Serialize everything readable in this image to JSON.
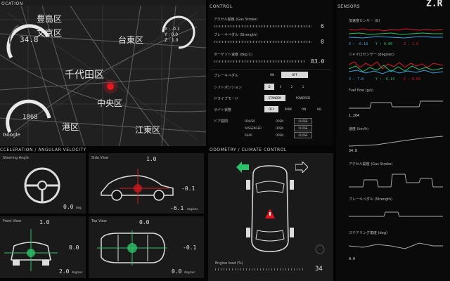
{
  "header": {
    "location_title": "OCATION",
    "control_title": "CONTROL",
    "sensors_title": "SENSORS",
    "accel_title": "CCELERATION / ANGULAR VELOCITY",
    "odo_title": "ODOMETRY / CLIMATE CONTROL",
    "logo": "Z.R"
  },
  "map": {
    "wards": [
      "豊島区",
      "文京区",
      "台東区",
      "千代田区",
      "中央区",
      "港区",
      "江東区"
    ],
    "speed_value": "34.8",
    "rpm_value": "1868",
    "google_label": "Google",
    "accel_x": "X : -0.1",
    "accel_y": "Y : 0.0",
    "accel_z": "Z : 1.0"
  },
  "control": {
    "accel_label": "アクセル開度 (Gas Stroke)",
    "accel_value": "6",
    "brake_label": "ブレーキペダル (Strength)",
    "brake_value": "0",
    "target_label": "ターゲット速度 (deg C)",
    "target_value": "83.0",
    "brake_pedal_label": "ブレーキペダル",
    "on_label": "ON",
    "off_label": "OFF",
    "shift_label": "シフトポジション",
    "shift_options": [
      "D",
      "3",
      "2",
      "1"
    ],
    "drive_label": "ドライブモード",
    "drive_options": [
      "STANDBY",
      "POWERED"
    ],
    "light_label": "ライト状態",
    "light_options": [
      "OFF",
      "PARK",
      "ON",
      "HB"
    ],
    "door_label": "ドア開閉",
    "door_rows": [
      {
        "name": "DRIVER",
        "state": "OPEN",
        "button": "CLOSE"
      },
      {
        "name": "PASSENGER",
        "state": "OPEN",
        "button": "CLOSE"
      },
      {
        "name": "REAR",
        "state": "OPEN",
        "button": "CLOSE"
      }
    ]
  },
  "sensors": {
    "accel_sensor_label": "加速度センサー (G)",
    "accel_readings": [
      "X : -0.18",
      "Y : 0.00",
      "Z : 1.0"
    ],
    "gyro_label": "ジャイロセンサー (deg/sec)",
    "gyro_readings": [
      "X : 7.8",
      "Y : -6.14",
      "Z : 0.02"
    ],
    "fuel_label": "Fuel flow (g/s)",
    "fuel_value": "1.204",
    "speed_label": "速度 (km/h)",
    "speed_value": "34.8",
    "gas_label": "アクセル開度 (Gas Stroke)",
    "brake_label": "ブレーキペダル (Strength)",
    "steer_label": "ステアリング角度 (deg)",
    "steer_value": "0.0"
  },
  "accel": {
    "steering_label": "Steering Angle",
    "steering_value": "0.0",
    "steering_unit": "deg",
    "side_label": "Side View",
    "side_z": "1.0",
    "side_x": "-0.1",
    "side_angle": "-6.1",
    "side_unit": "deg/sec",
    "front_label": "Front View",
    "front_z": "1.0",
    "front_y": "0.0",
    "front_angle": "2.0",
    "front_unit": "deg/sec",
    "top_label": "Top View",
    "top_y": "0.0",
    "top_x": "-0.1",
    "top_angle": "0.0",
    "top_unit": "deg/sec"
  },
  "odo": {
    "engine_label": "Engine load (%)",
    "engine_value": "34"
  }
}
